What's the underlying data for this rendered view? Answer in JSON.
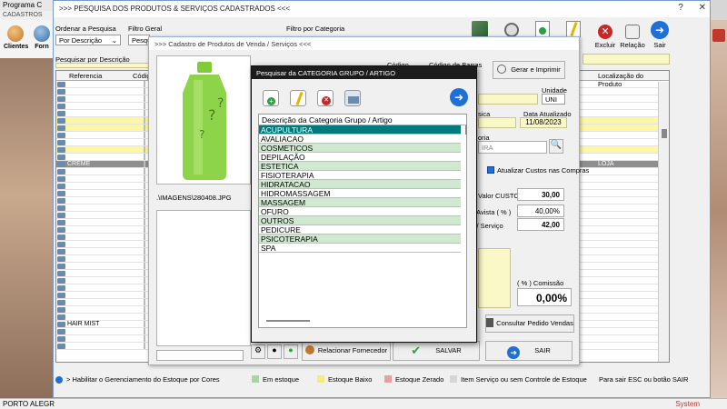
{
  "backdrop": {
    "app_title": "Programa C",
    "menu_label": "CADASTROS",
    "toolbar": [
      {
        "label": "Clientes"
      },
      {
        "label": "Forn"
      }
    ],
    "bottom_status": "PORTO ALEGR",
    "bottom_right": "System"
  },
  "main_window": {
    "title": ">>>  PESQUISA DOS PRODUTOS & SERVIÇOS CADASTRADOS  <<<",
    "controls": [
      "?",
      "✕"
    ],
    "order_label": "Ordenar a Pesquisa",
    "order_value": "Por Descrição",
    "filter_label": "Filtro Geral",
    "filter_value": "Pesqui",
    "category_filter_label": "Filtro por Categoria",
    "search_label": "Pesquisar por Descrição",
    "toolbar": [
      {
        "label": "Excluir",
        "icon": "delete-icon"
      },
      {
        "label": "Relação",
        "icon": "report-icon"
      },
      {
        "label": "Sair",
        "icon": "exit-arrow-icon"
      }
    ],
    "grid": {
      "columns": [
        "Referencia",
        "Códig",
        "Localização do Produto"
      ],
      "rows": [
        {
          "ref": "",
          "loc": "",
          "style": "plain"
        },
        {
          "ref": "",
          "loc": "",
          "style": "plain"
        },
        {
          "ref": "",
          "loc": "",
          "style": "plain"
        },
        {
          "ref": "",
          "loc": "",
          "style": "plain"
        },
        {
          "ref": "",
          "loc": "",
          "style": "plain"
        },
        {
          "ref": "",
          "loc": "",
          "style": "hl"
        },
        {
          "ref": "",
          "loc": "",
          "style": "hl"
        },
        {
          "ref": "",
          "loc": "",
          "style": "plain"
        },
        {
          "ref": "",
          "loc": "",
          "style": "plain"
        },
        {
          "ref": "",
          "loc": "",
          "style": "hl"
        },
        {
          "ref": "",
          "loc": "",
          "style": "plain"
        },
        {
          "ref": "CREME",
          "loc": "LOJA",
          "style": "dk"
        },
        {
          "ref": "",
          "loc": "",
          "style": "plain"
        },
        {
          "ref": "",
          "loc": "",
          "style": "plain"
        },
        {
          "ref": "",
          "loc": "",
          "style": "plain"
        },
        {
          "ref": "",
          "loc": "",
          "style": "plain"
        },
        {
          "ref": "",
          "loc": "",
          "style": "plain"
        },
        {
          "ref": "",
          "loc": "",
          "style": "plain"
        },
        {
          "ref": "",
          "loc": "",
          "style": "plain"
        },
        {
          "ref": "",
          "loc": "",
          "style": "plain"
        },
        {
          "ref": "",
          "loc": "",
          "style": "plain"
        },
        {
          "ref": "",
          "loc": "",
          "style": "plain"
        },
        {
          "ref": "",
          "loc": "",
          "style": "plain"
        },
        {
          "ref": "",
          "loc": "",
          "style": "plain"
        },
        {
          "ref": "",
          "loc": "",
          "style": "plain"
        },
        {
          "ref": "",
          "loc": "",
          "style": "plain"
        },
        {
          "ref": "",
          "loc": "",
          "style": "plain"
        },
        {
          "ref": "",
          "loc": "",
          "style": "plain"
        },
        {
          "ref": "",
          "loc": "",
          "style": "plain"
        },
        {
          "ref": "",
          "loc": "",
          "style": "plain"
        },
        {
          "ref": "",
          "loc": "",
          "style": "plain"
        },
        {
          "ref": "",
          "loc": "",
          "style": "plain"
        },
        {
          "ref": "",
          "loc": "",
          "style": "plain"
        },
        {
          "ref": "HAIR MIST",
          "loc": "",
          "style": "plain"
        },
        {
          "ref": "",
          "loc": "",
          "style": "plain"
        },
        {
          "ref": "",
          "loc": "",
          "style": "plain"
        },
        {
          "ref": "",
          "loc": "",
          "style": "plain"
        }
      ]
    },
    "legend": {
      "toggle_label": "> Habilitar o Gerenciamento do Estoque por Cores",
      "items": [
        {
          "label": "Em estoque",
          "color": "#a9d3a9"
        },
        {
          "label": "Estoque Baixo",
          "color": "#f2ec7a"
        },
        {
          "label": "Estoque Zerado",
          "color": "#e8a0a0"
        },
        {
          "label": "Item Serviço ou sem Controle de Estoque",
          "color": "#d6d6d6"
        }
      ],
      "hint": "Para sair ESC ou botão SAIR"
    }
  },
  "product_window": {
    "title": ">>>  Cadastro de Produtos de Venda / Serviços  <<<",
    "image_path": ".\\IMAGENS\\280408.JPG",
    "codigo_label": "Código",
    "barcode_label": "Código de Barras",
    "print_button": "Gerar e Imprimir",
    "unidade_label": "Unidade",
    "unidade_value": "UNI",
    "sica_label": "sica",
    "date_label": "Data Atualizado",
    "date_value": "11/08/2023",
    "categoria_label": "oria",
    "categoria_value": "IRA",
    "update_costs_label": "Atualizar Custos nas Compras",
    "custo_label": "Valor CUSTO",
    "custo_value": "30,00",
    "avista_label": "em Avista ( % )",
    "avista_value": "40,00%",
    "servico_label": "uto / Serviço",
    "servico_value": "42,00",
    "comissao_label": "( % ) Comissão",
    "comissao_value": "0,00%",
    "consult_button": "Consultar Pedido Vendas",
    "supplier_button": "Relacionar Fornecedor",
    "save_button": "SALVAR",
    "exit_button": "SAIR"
  },
  "category_dialog": {
    "title": "Pesquisar da CATEGORIA GRUPO / ARTIGO",
    "column_header": "Descrição da Categoria Grupo / Artigo",
    "items": [
      {
        "label": "ACUPULTURA",
        "style": "sel"
      },
      {
        "label": "AVALIACAO",
        "style": "plain"
      },
      {
        "label": "COSMETICOS",
        "style": "alt"
      },
      {
        "label": "DEPILAÇÃO",
        "style": "plain"
      },
      {
        "label": "ESTETICA",
        "style": "alt"
      },
      {
        "label": "FISIOTERAPIA",
        "style": "plain"
      },
      {
        "label": "HIDRATACAO",
        "style": "alt"
      },
      {
        "label": "HIDROMASSAGEM",
        "style": "plain"
      },
      {
        "label": "MASSAGEM",
        "style": "alt"
      },
      {
        "label": "OFURO",
        "style": "plain"
      },
      {
        "label": "OUTROS",
        "style": "alt"
      },
      {
        "label": "PEDICURE",
        "style": "plain"
      },
      {
        "label": "PSICOTERAPIA",
        "style": "alt"
      },
      {
        "label": "SPA",
        "style": "plain"
      }
    ],
    "toolbar_icons": [
      "add-icon",
      "edit-icon",
      "delete-icon",
      "print-icon"
    ]
  }
}
